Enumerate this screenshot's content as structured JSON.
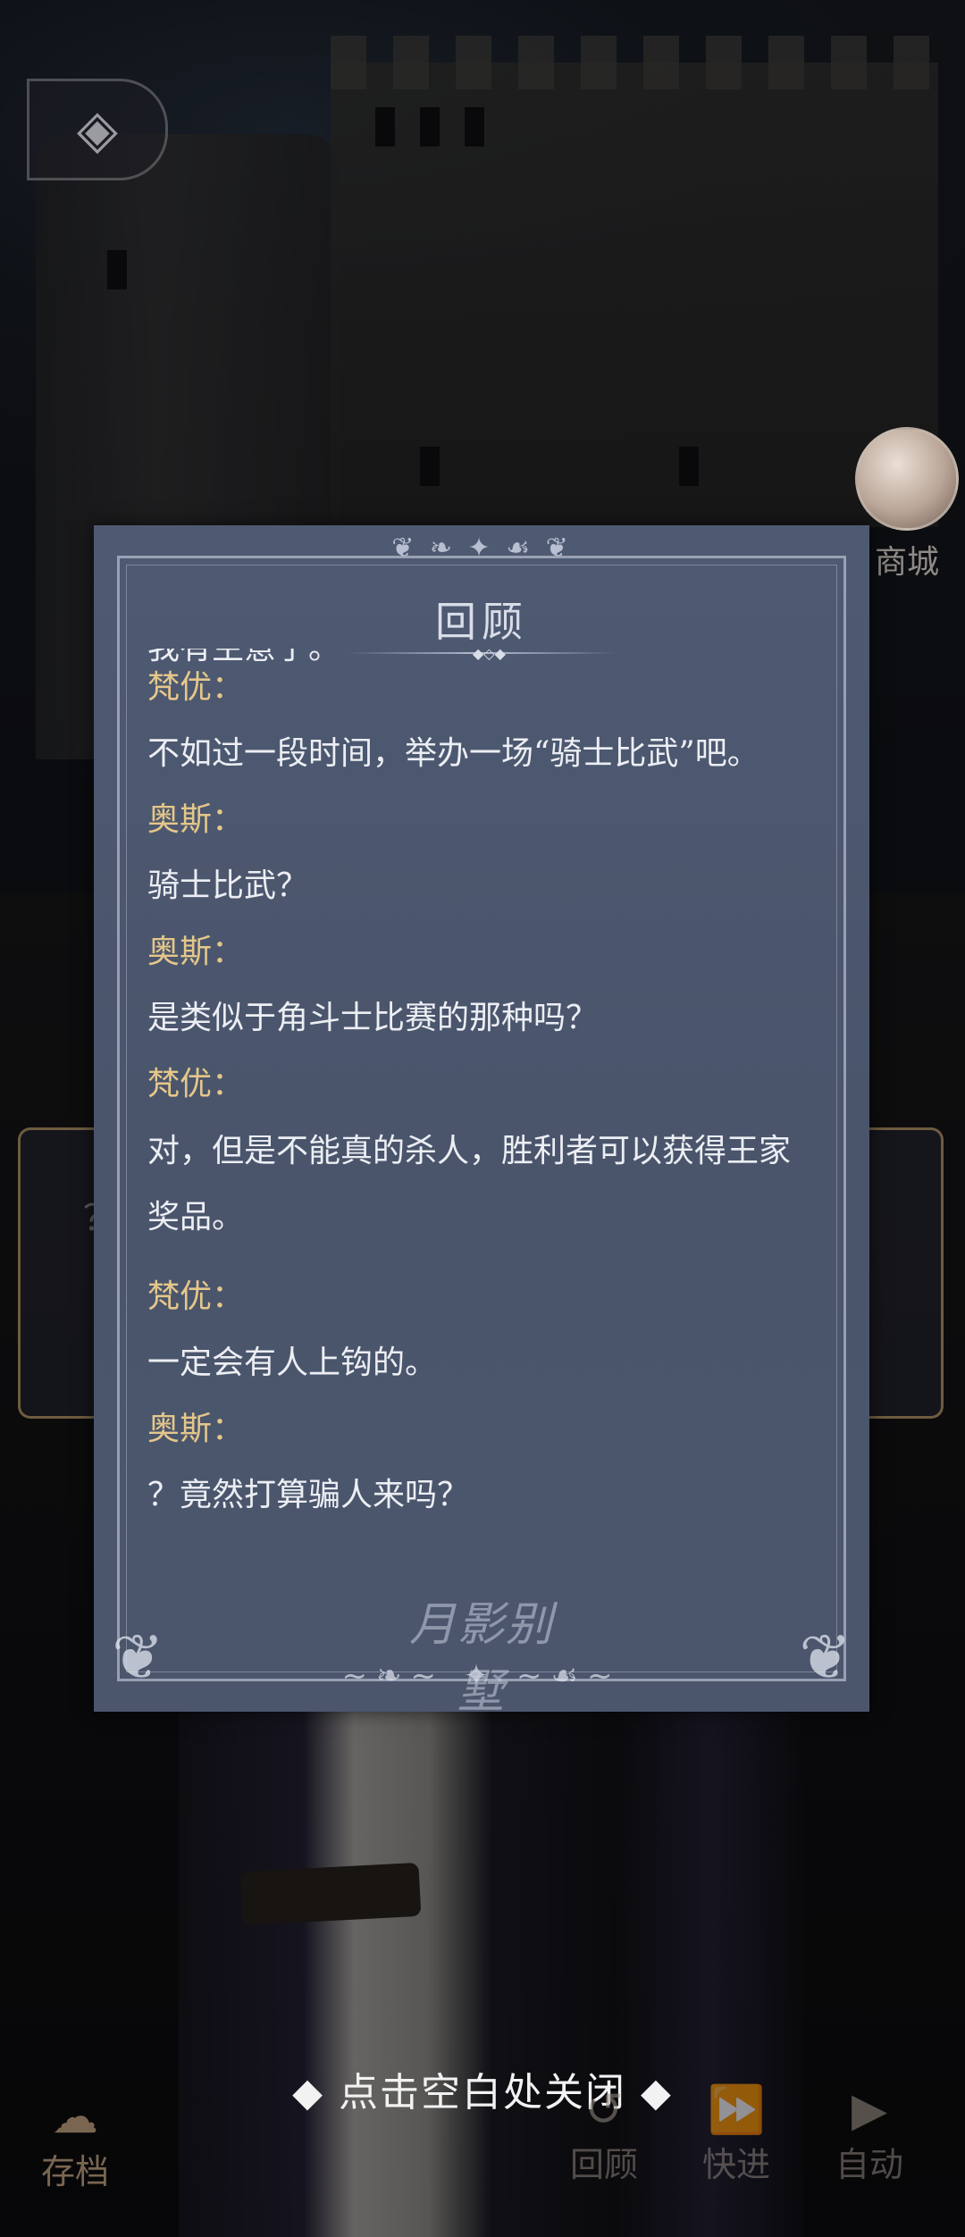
{
  "top": {
    "back_icon": "back-arrow-icon"
  },
  "shop": {
    "label": "商城"
  },
  "behind_dialog": {
    "text": "？"
  },
  "panel": {
    "title": "回顾",
    "partial_top_text": "我有主意了。",
    "entries": [
      {
        "type": "speaker",
        "text": "梵优："
      },
      {
        "type": "text",
        "text": "不如过一段时间，举办一场“骑士比武”吧。"
      },
      {
        "type": "speaker",
        "text": "奥斯："
      },
      {
        "type": "text",
        "text": "骑士比武？"
      },
      {
        "type": "speaker",
        "text": "奥斯："
      },
      {
        "type": "text",
        "text": "是类似于角斗士比赛的那种吗？"
      },
      {
        "type": "speaker",
        "text": "梵优："
      },
      {
        "type": "text",
        "text": "对，但是不能真的杀人，胜利者可以获得王家奖品。"
      },
      {
        "type": "speaker",
        "text": "梵优："
      },
      {
        "type": "text",
        "text": "一定会有人上钩的。"
      },
      {
        "type": "speaker",
        "text": "奥斯："
      },
      {
        "type": "text",
        "text": "？竟然打算骗人来吗？"
      }
    ],
    "logo_text": "月影别墅"
  },
  "close_hint": "◆ 点击空白处关闭 ◆",
  "toolbar": {
    "save": "存档",
    "review": "回顾",
    "fast_forward": "快进",
    "auto": "自动"
  },
  "colors": {
    "panel_bg": "#4b566d",
    "speaker": "#e5c78a",
    "text": "#eceef3"
  }
}
